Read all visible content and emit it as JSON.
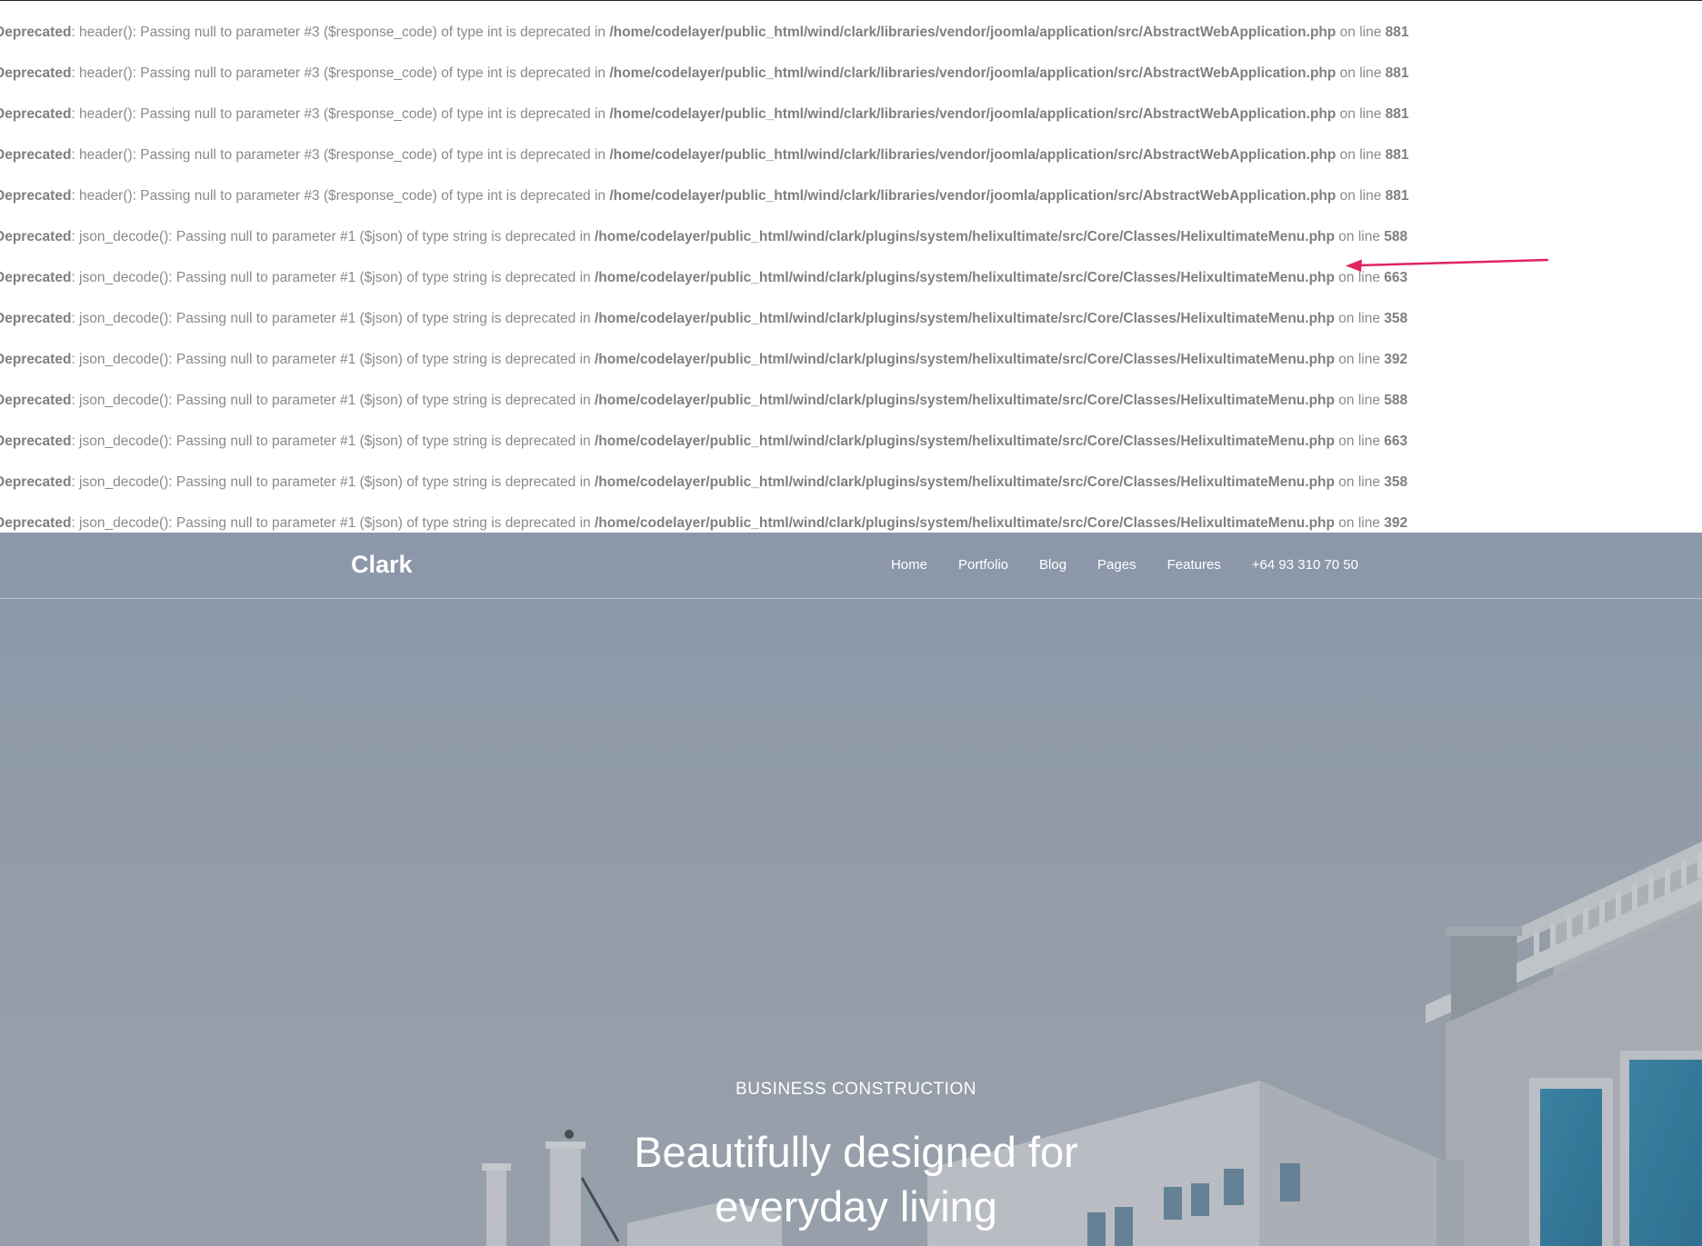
{
  "warnings": [
    {
      "type": "Deprecated",
      "message": ": header(): Passing null to parameter #3 ($response_code) of type int is deprecated in ",
      "file": "/home/codelayer/public_html/wind/clark/libraries/vendor/joomla/application/src/AbstractWebApplication.php",
      "on_line": " on line ",
      "line": "881"
    },
    {
      "type": "Deprecated",
      "message": ": header(): Passing null to parameter #3 ($response_code) of type int is deprecated in ",
      "file": "/home/codelayer/public_html/wind/clark/libraries/vendor/joomla/application/src/AbstractWebApplication.php",
      "on_line": " on line ",
      "line": "881"
    },
    {
      "type": "Deprecated",
      "message": ": header(): Passing null to parameter #3 ($response_code) of type int is deprecated in ",
      "file": "/home/codelayer/public_html/wind/clark/libraries/vendor/joomla/application/src/AbstractWebApplication.php",
      "on_line": " on line ",
      "line": "881"
    },
    {
      "type": "Deprecated",
      "message": ": header(): Passing null to parameter #3 ($response_code) of type int is deprecated in ",
      "file": "/home/codelayer/public_html/wind/clark/libraries/vendor/joomla/application/src/AbstractWebApplication.php",
      "on_line": " on line ",
      "line": "881"
    },
    {
      "type": "Deprecated",
      "message": ": header(): Passing null to parameter #3 ($response_code) of type int is deprecated in ",
      "file": "/home/codelayer/public_html/wind/clark/libraries/vendor/joomla/application/src/AbstractWebApplication.php",
      "on_line": " on line ",
      "line": "881"
    },
    {
      "type": "Deprecated",
      "message": ": json_decode(): Passing null to parameter #1 ($json) of type string is deprecated in ",
      "file": "/home/codelayer/public_html/wind/clark/plugins/system/helixultimate/src/Core/Classes/HelixultimateMenu.php",
      "on_line": " on line ",
      "line": "588"
    },
    {
      "type": "Deprecated",
      "message": ": json_decode(): Passing null to parameter #1 ($json) of type string is deprecated in ",
      "file": "/home/codelayer/public_html/wind/clark/plugins/system/helixultimate/src/Core/Classes/HelixultimateMenu.php",
      "on_line": " on line ",
      "line": "663"
    },
    {
      "type": "Deprecated",
      "message": ": json_decode(): Passing null to parameter #1 ($json) of type string is deprecated in ",
      "file": "/home/codelayer/public_html/wind/clark/plugins/system/helixultimate/src/Core/Classes/HelixultimateMenu.php",
      "on_line": " on line ",
      "line": "358"
    },
    {
      "type": "Deprecated",
      "message": ": json_decode(): Passing null to parameter #1 ($json) of type string is deprecated in ",
      "file": "/home/codelayer/public_html/wind/clark/plugins/system/helixultimate/src/Core/Classes/HelixultimateMenu.php",
      "on_line": " on line ",
      "line": "392"
    },
    {
      "type": "Deprecated",
      "message": ": json_decode(): Passing null to parameter #1 ($json) of type string is deprecated in ",
      "file": "/home/codelayer/public_html/wind/clark/plugins/system/helixultimate/src/Core/Classes/HelixultimateMenu.php",
      "on_line": " on line ",
      "line": "588"
    },
    {
      "type": "Deprecated",
      "message": ": json_decode(): Passing null to parameter #1 ($json) of type string is deprecated in ",
      "file": "/home/codelayer/public_html/wind/clark/plugins/system/helixultimate/src/Core/Classes/HelixultimateMenu.php",
      "on_line": " on line ",
      "line": "663"
    },
    {
      "type": "Deprecated",
      "message": ": json_decode(): Passing null to parameter #1 ($json) of type string is deprecated in ",
      "file": "/home/codelayer/public_html/wind/clark/plugins/system/helixultimate/src/Core/Classes/HelixultimateMenu.php",
      "on_line": " on line ",
      "line": "358"
    },
    {
      "type": "Deprecated",
      "message": ": json_decode(): Passing null to parameter #1 ($json) of type string is deprecated in ",
      "file": "/home/codelayer/public_html/wind/clark/plugins/system/helixultimate/src/Core/Classes/HelixultimateMenu.php",
      "on_line": " on line ",
      "line": "392"
    }
  ],
  "annotation": {
    "arrow_color": "#e0245e",
    "icon": "arrow-left-icon"
  },
  "site": {
    "logo": "Clark",
    "nav": [
      "Home",
      "Portfolio",
      "Blog",
      "Pages",
      "Features",
      "+64 93 310 70 50"
    ]
  },
  "hero": {
    "eyebrow": "BUSINESS CONSTRUCTION",
    "headline_line1": "Beautifully designed for",
    "headline_line2": "everyday living",
    "overlay_color": "#8f9cad"
  }
}
